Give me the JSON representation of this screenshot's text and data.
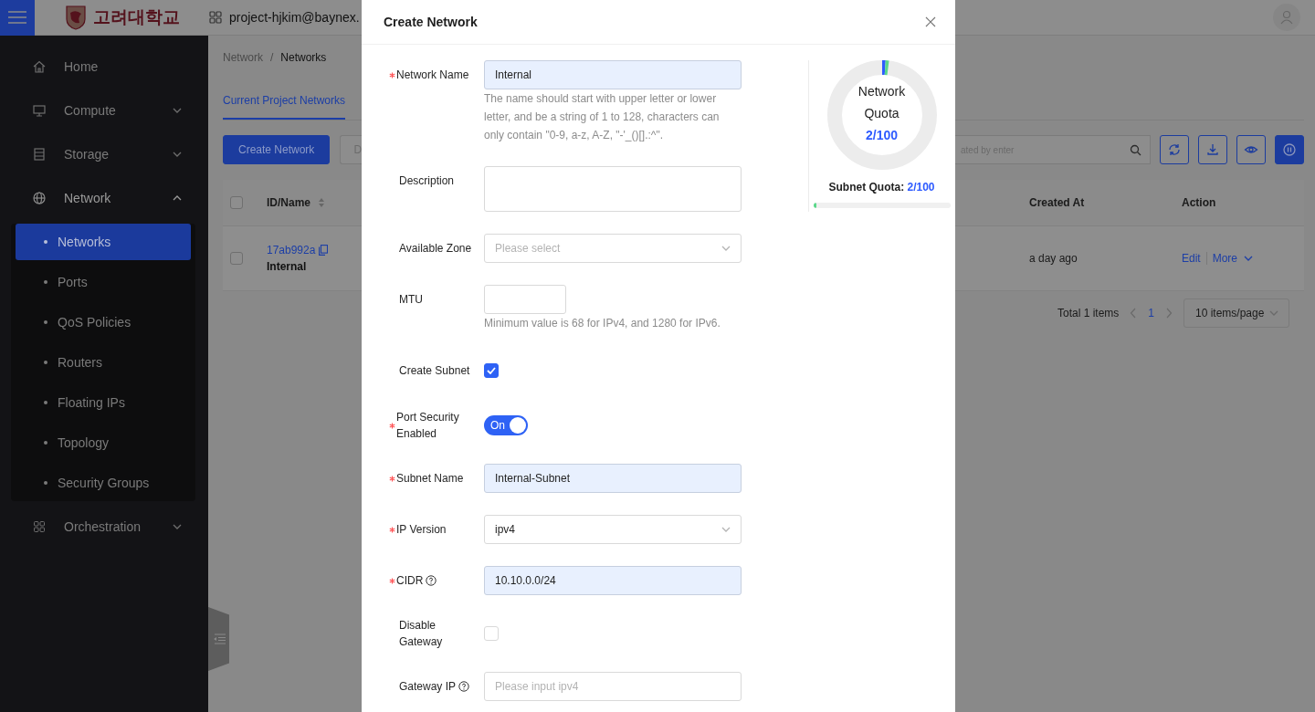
{
  "topbar": {
    "logo_text": "고려대학교",
    "project": "project-hjkim@baynex."
  },
  "sidebar": {
    "items": [
      {
        "label": "Home",
        "kind": "link"
      },
      {
        "label": "Compute",
        "kind": "group",
        "expanded": false
      },
      {
        "label": "Storage",
        "kind": "group",
        "expanded": false
      },
      {
        "label": "Network",
        "kind": "group",
        "expanded": true,
        "children": [
          {
            "label": "Networks",
            "selected": true
          },
          {
            "label": "Ports",
            "selected": false
          },
          {
            "label": "QoS Policies",
            "selected": false
          },
          {
            "label": "Routers",
            "selected": false
          },
          {
            "label": "Floating IPs",
            "selected": false
          },
          {
            "label": "Topology",
            "selected": false
          },
          {
            "label": "Security Groups",
            "selected": false
          }
        ]
      },
      {
        "label": "Orchestration",
        "kind": "group",
        "expanded": false
      }
    ]
  },
  "breadcrumb": {
    "items": [
      "Network",
      "Networks"
    ],
    "separator": "/"
  },
  "tabs": [
    {
      "label": "Current Project Networks",
      "selected": true
    }
  ],
  "toolbar": {
    "buttons": [
      {
        "label": "Create Network",
        "kind": "primary"
      },
      {
        "label": "D",
        "kind": "default"
      }
    ],
    "search_placeholder": "ated by enter"
  },
  "table": {
    "all_selected": false,
    "columns": [
      "ID/Name",
      "Created At",
      "Action"
    ],
    "rows": [
      {
        "selected": false,
        "id": "17ab992a",
        "name": "Internal",
        "created_at": "a day ago",
        "actions": [
          "Edit",
          "More"
        ]
      }
    ]
  },
  "pagination": {
    "total": "Total 1 items",
    "pages": [
      {
        "label": "1",
        "selected": true
      }
    ],
    "page_size": "10 items/page"
  },
  "modal": {
    "title": "Create Network",
    "fields": [
      {
        "kind": "input",
        "label": "Network Name",
        "required": true,
        "value": "Internal",
        "autofilled": true,
        "help": "The name should start with upper letter or lower letter, and be a string of 1 to 128, characters can only contain \"0-9, a-z, A-Z, \"-'_()[].:^\"."
      },
      {
        "kind": "textarea",
        "label": "Description",
        "required": false
      },
      {
        "kind": "select",
        "label": "Available Zone",
        "required": false,
        "placeholder": "Please select"
      },
      {
        "kind": "number",
        "label": "MTU",
        "required": false,
        "autofilled": false,
        "help": "Minimum value is 68 for IPv4, and 1280 for IPv6."
      },
      {
        "kind": "checkbox",
        "label": "Create Subnet",
        "required": false,
        "checked": true
      },
      {
        "kind": "switch",
        "label": "Port Security Enabled",
        "required": true,
        "on": true,
        "text": "On"
      },
      {
        "kind": "input",
        "label": "Subnet Name",
        "required": true,
        "value": "Internal-Subnet",
        "autofilled": true
      },
      {
        "kind": "select",
        "label": "IP Version",
        "required": true,
        "value": "ipv4"
      },
      {
        "kind": "input",
        "label": "CIDR",
        "required": true,
        "info": true,
        "value": "10.10.0.0/24",
        "autofilled": true
      },
      {
        "kind": "checkbox",
        "label": "Disable Gateway",
        "required": false,
        "checked": false
      },
      {
        "kind": "input",
        "label": "Gateway IP",
        "required": false,
        "info": true,
        "placeholder": "Please input ipv4",
        "autofilled": false
      }
    ],
    "quota": {
      "network": {
        "title": "Network Quota",
        "value": "2/100",
        "segments": [
          {
            "color": "#2e5bff"
          },
          {
            "color": "#5ad88a"
          }
        ]
      },
      "subnet": {
        "label": "Subnet Quota:",
        "value": "2/100",
        "level": 0.02
      }
    }
  }
}
